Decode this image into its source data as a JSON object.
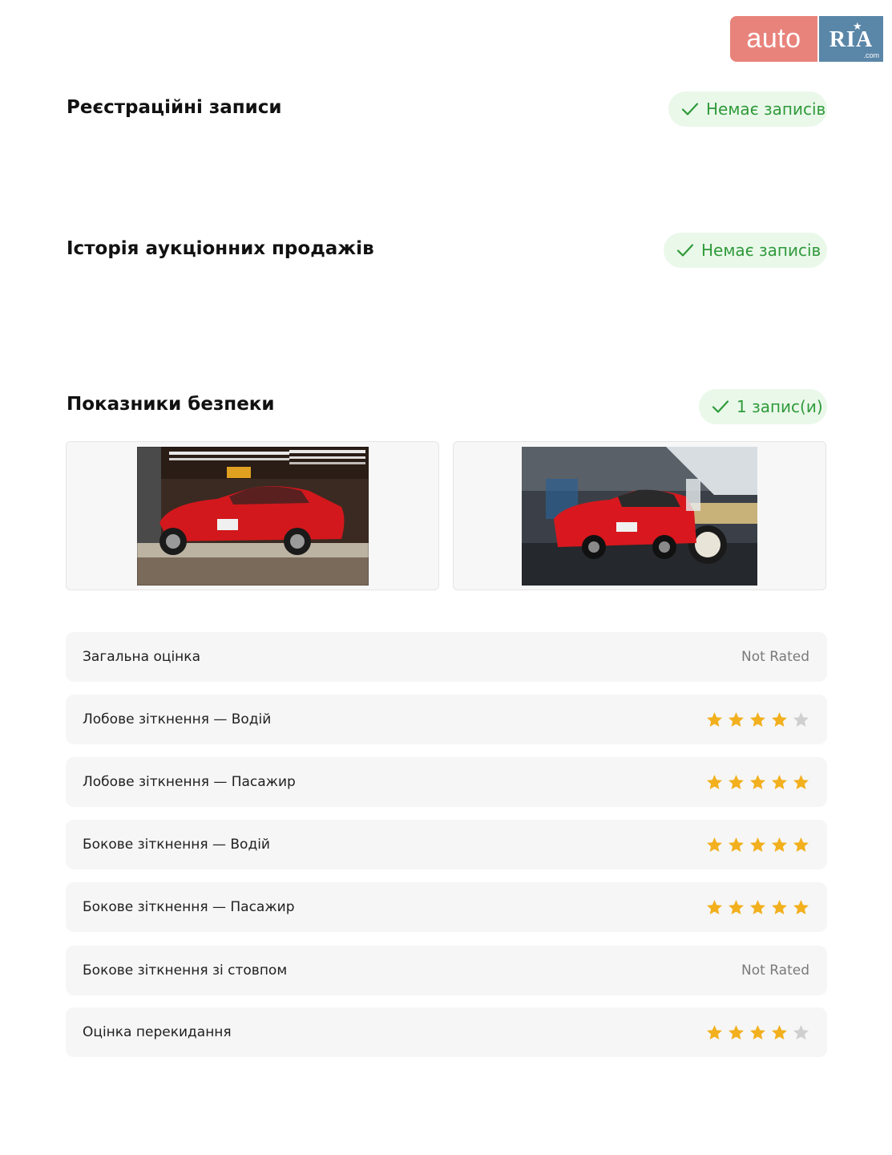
{
  "logo": {
    "left_text": "auto",
    "right_text": "RIA",
    "right_suffix": ".com"
  },
  "sections": {
    "registration": {
      "title": "Реєстраційні записи",
      "badge": "Немає записів"
    },
    "auction": {
      "title": "Історія аукціонних продажів",
      "badge": "Немає записів"
    },
    "safety": {
      "title": "Показники безпеки",
      "badge": "1 запис(и)"
    }
  },
  "photos": [
    {
      "name": "frontal-crash-test-photo"
    },
    {
      "name": "side-crash-test-photo"
    }
  ],
  "ratings": [
    {
      "label": "Загальна оцінка",
      "value": "Not Rated"
    },
    {
      "label": "Лобове зіткнення — Водій",
      "stars": 4,
      "max": 5
    },
    {
      "label": "Лобове зіткнення — Пасажир",
      "stars": 5,
      "max": 5
    },
    {
      "label": "Бокове зіткнення — Водій",
      "stars": 5,
      "max": 5
    },
    {
      "label": "Бокове зіткнення — Пасажир",
      "stars": 5,
      "max": 5
    },
    {
      "label": "Бокове зіткнення зі стовпом",
      "value": "Not Rated"
    },
    {
      "label": "Оцінка перекидання",
      "stars": 4,
      "max": 5
    }
  ],
  "colors": {
    "star_filled": "#f2b01e",
    "star_empty": "#cfcfcf",
    "badge_text": "#2f9a3a",
    "badge_bg": "#eaf8ea"
  }
}
